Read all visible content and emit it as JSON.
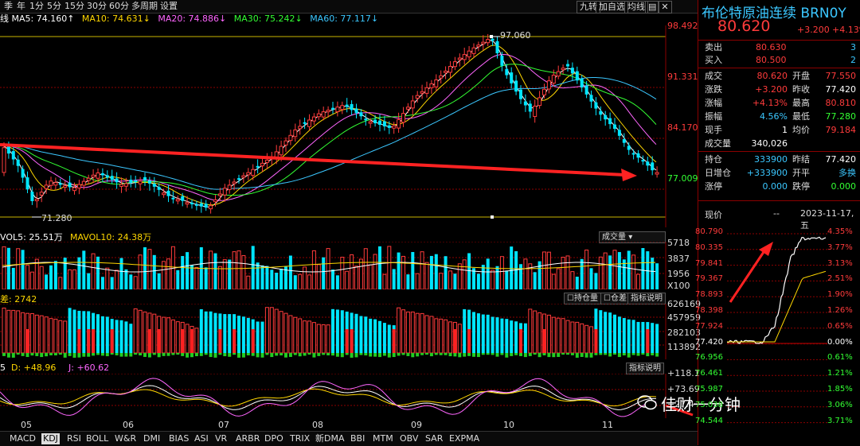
{
  "toolbar": {
    "periods": [
      "季",
      "年",
      "1分",
      "5分",
      "15分",
      "30分",
      "60分",
      "多周期",
      "设置"
    ],
    "right_buttons": [
      "九转",
      "加自选",
      "均线"
    ],
    "icons": [
      "settings-icon",
      "close-icon"
    ]
  },
  "ma_legend": [
    {
      "text": "线 MA5: 74.160↑",
      "color": "#ffffff"
    },
    {
      "text": "MA10: 74.631↓",
      "color": "#ffd700"
    },
    {
      "text": "MA20: 74.886↓",
      "color": "#ff66ff"
    },
    {
      "text": "MA30: 75.242↓",
      "color": "#33ff33"
    },
    {
      "text": "MA60: 77.117↓",
      "color": "#3bc7ff"
    }
  ],
  "price_axis": [
    "98.492",
    "91.331",
    "84.170",
    "77.009"
  ],
  "price_marks": {
    "high": "97.060",
    "low": "71.280"
  },
  "vol_legend": {
    "vol5": "VOL5: 25.51万",
    "mavol10": "MAVOL10: 24.38万",
    "selector": "成交量"
  },
  "vol_axis": [
    "5718",
    "3837",
    "1956",
    "X100"
  ],
  "oi_legend": {
    "diff": "差: 2742",
    "btn1": "持仓量",
    "btn2": "仓差",
    "btn3": "指标说明"
  },
  "oi_axis": [
    "626169",
    "457959",
    "282103",
    "113892"
  ],
  "kdj_legend": {
    "k": "5",
    "d": "D: +48.96",
    "j": "J: +60.62",
    "btn": "指标说明"
  },
  "kdj_axis": [
    "+118.1",
    "+73.69",
    "+27.4"
  ],
  "months": [
    "05",
    "06",
    "07",
    "08",
    "09",
    "10",
    "11"
  ],
  "bottom_tabs": [
    "MACD",
    "KDJ",
    "RSI",
    "BOLL",
    "W&R",
    "DMI",
    "BIAS",
    "ASI",
    "VR",
    "ARBR",
    "DPO",
    "TRIX",
    "新DMA",
    "BBI",
    "MTM",
    "OBV",
    "SAR",
    "EXPMA"
  ],
  "active_tab": "KDJ",
  "quote": {
    "title": "布伦特原油连续 BRN0Y",
    "price": "80.620",
    "change": "+3.200",
    "pct": "+4.13%",
    "sell": {
      "label": "卖出",
      "price": "80.630",
      "vol": "3"
    },
    "buy": {
      "label": "买入",
      "price": "80.500",
      "vol": "2"
    },
    "rows": [
      {
        "l1": "成交",
        "v1": "80.620",
        "l2": "开盘",
        "v2": "77.550",
        "c1": "#ff3b3b",
        "c2": "#ff3b3b"
      },
      {
        "l1": "涨跌",
        "v1": "+3.200",
        "l2": "昨收",
        "v2": "77.420",
        "c1": "#ff3b3b",
        "c2": "#ffffff"
      },
      {
        "l1": "涨幅",
        "v1": "+4.13%",
        "l2": "最高",
        "v2": "80.810",
        "c1": "#ff3b3b",
        "c2": "#ff3b3b"
      },
      {
        "l1": "振幅",
        "v1": "4.56%",
        "l2": "最低",
        "v2": "77.280",
        "c1": "#3bc7ff",
        "c2": "#33ff33"
      },
      {
        "l1": "现手",
        "v1": "1",
        "l2": "均价",
        "v2": "79.184",
        "c1": "#ffffff",
        "c2": "#ff3b3b"
      },
      {
        "l1": "成交量",
        "v1": "340,026",
        "l2": "",
        "v2": "",
        "c1": "#ffffff",
        "c2": "#ffffff"
      }
    ],
    "rows2": [
      {
        "l1": "持仓",
        "v1": "333900",
        "l2": "昨结",
        "v2": "77.420",
        "c1": "#3bc7ff",
        "c2": "#ffffff"
      },
      {
        "l1": "日增仓",
        "v1": "+333900",
        "l2": "开平",
        "v2": "多换",
        "c1": "#3bc7ff",
        "c2": "#3bc7ff"
      },
      {
        "l1": "涨停",
        "v1": "0.000",
        "l2": "跌停",
        "v2": "0.000",
        "c1": "#3bc7ff",
        "c2": "#33ff33"
      }
    ]
  },
  "minichart": {
    "label": "现价",
    "dash": "--",
    "date": "2023-11-17,五",
    "left_axis": [
      "80.790",
      "80.335",
      "79.841",
      "79.367",
      "78.893",
      "78.398",
      "77.924",
      "77.420",
      "76.956",
      "76.461",
      "75.987",
      "75.038",
      "74.544"
    ],
    "right_axis": [
      "4.35%",
      "3.77%",
      "3.13%",
      "2.51%",
      "1.90%",
      "1.26%",
      "0.65%",
      "0.00%",
      "0.61%",
      "1.21%",
      "1.85%",
      "3.06%",
      "3.71%"
    ]
  },
  "watermark": "佳财一分钟",
  "colors": {
    "up": "#ff3b3b",
    "down": "#00e5ff",
    "grid": "#8b0000",
    "arrow": "#ff2222"
  }
}
